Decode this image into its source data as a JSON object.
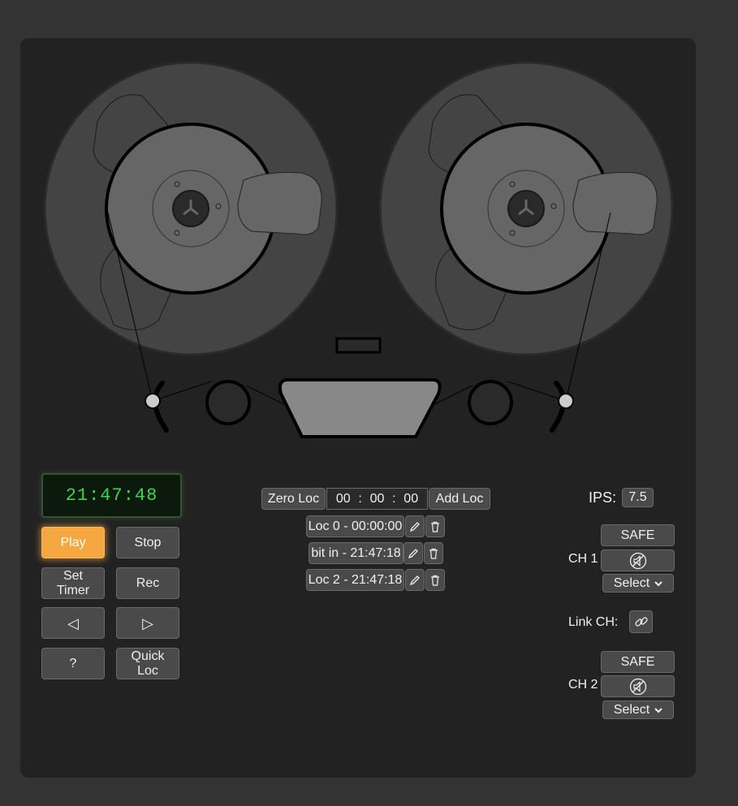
{
  "counter": {
    "time": "21:47:48"
  },
  "transport": {
    "play_label": "Play",
    "stop_label": "Stop",
    "set_timer_line1": "Set",
    "set_timer_line2": "Timer",
    "rec_label": "Rec",
    "rewind_label": "◁",
    "forward_label": "▷",
    "help_label": "?",
    "quick_loc_line1": "Quick",
    "quick_loc_line2": "Loc"
  },
  "locator": {
    "zero_loc_label": "Zero Loc",
    "add_loc_label": "Add Loc",
    "hh": "00",
    "mm": "00",
    "ss": "00",
    "sep": ":",
    "entries": [
      {
        "label": "Loc 0 - 00:00:00"
      },
      {
        "label": "bit in - 21:47:18"
      },
      {
        "label": "Loc 2 - 21:47:18"
      }
    ]
  },
  "settings": {
    "ips_label": "IPS:",
    "ips_value": "7.5",
    "ch1_label": "CH 1",
    "ch2_label": "CH 2",
    "safe_label": "SAFE",
    "select_label": "Select",
    "link_label": "Link CH:"
  },
  "colors": {
    "accent": "#f5a742",
    "counter_text": "#39d64a",
    "panel": "#222222"
  }
}
